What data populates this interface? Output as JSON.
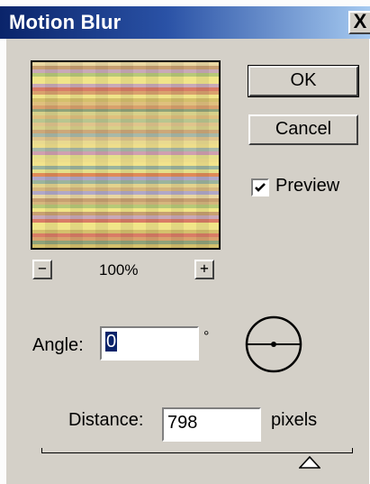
{
  "window": {
    "title": "Motion Blur",
    "close_label": "X"
  },
  "preview": {
    "zoom_level": "100%",
    "zoom_out_label": "−",
    "zoom_in_label": "+",
    "stripe_colors": [
      "#e9d7a2",
      "#dfc07e",
      "#e5e08b",
      "#f1e687",
      "#cda878",
      "#e3d38d",
      "#d9a16d",
      "#eede8b",
      "#c8a071",
      "#b8c690",
      "#e08a58",
      "#f0e48a",
      "#a8b9a8",
      "#d6b77e",
      "#8fa37a",
      "#f2e38c",
      "#c9a9b8",
      "#e0c48c",
      "#b0a8c8",
      "#d4c06c",
      "#cfa0b0",
      "#b7c978",
      "#d8d18a",
      "#9bb49d",
      "#d97c66",
      "#e9da90"
    ]
  },
  "buttons": {
    "ok_label": "OK",
    "cancel_label": "Cancel"
  },
  "preview_toggle": {
    "label": "Preview",
    "checked": true
  },
  "angle": {
    "label": "Angle:",
    "value": "0",
    "unit": "°"
  },
  "distance": {
    "label": "Distance:",
    "value": "798",
    "unit": "pixels",
    "slider_fraction": 0.86
  },
  "icons": {
    "dial": "angle-dial-icon",
    "thumb": "slider-thumb-icon",
    "check": "checkmark-icon"
  }
}
